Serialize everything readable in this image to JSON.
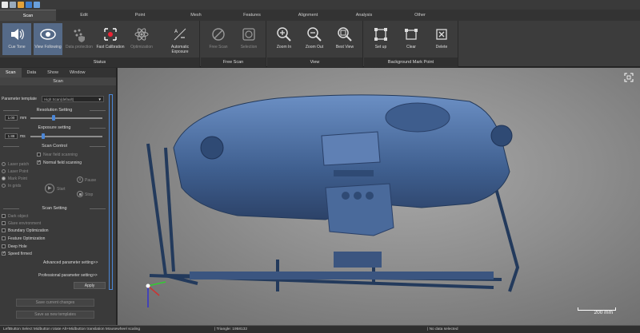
{
  "menu_tabs": [
    "Scan",
    "Edit",
    "Point",
    "Mesh",
    "Features",
    "Alignment",
    "Analysis",
    "Other"
  ],
  "ribbon": {
    "status_group": {
      "title": "Status",
      "buttons": [
        "Cue Tone",
        "View Following",
        "Data protection",
        "Fast Calibration",
        "Optimization",
        "Automatic Exposure"
      ]
    },
    "free_scan_group": {
      "title": "Free Scan",
      "buttons": [
        "Free Scan",
        "Selection"
      ]
    },
    "view_group": {
      "title": "View",
      "buttons": [
        "Zoom In",
        "Zoom Out",
        "Best View"
      ]
    },
    "mark_group": {
      "title": "Background Mark Point",
      "buttons": [
        "Set up",
        "Clear",
        "Delete"
      ]
    }
  },
  "panel": {
    "tabs": [
      "Scan",
      "Data",
      "Show",
      "Window"
    ],
    "heading": "Scan",
    "param_label": "Parameter template",
    "param_value": "High Scan(default)",
    "resolution": {
      "title": "Resolution Setting",
      "value": "1.00",
      "unit": "mm",
      "level": 0.3
    },
    "exposure": {
      "title": "Exposure setting",
      "value": "1.88",
      "unit": "ms",
      "level": 0.15
    },
    "scan_control": {
      "title": "Scan Control",
      "far_field": "Near field scanning",
      "normal_field": "Normal field scanning",
      "modes": [
        "Laser patch",
        "Laser Point",
        "Mark Point",
        "In grids"
      ],
      "start": "Start",
      "pause": "Pause",
      "stop": "Stop"
    },
    "scan_setting": {
      "title": "Scan Setting",
      "items": [
        {
          "label": "Dark object",
          "checked": false,
          "enabled": false
        },
        {
          "label": "Glare environment",
          "checked": false,
          "enabled": false
        },
        {
          "label": "Boundary Optimization",
          "checked": false,
          "enabled": true
        },
        {
          "label": "Feature Optimization",
          "checked": false,
          "enabled": true
        },
        {
          "label": "Deep Hole",
          "checked": false,
          "enabled": true
        },
        {
          "label": "Speed firmed",
          "checked": true,
          "enabled": true
        }
      ]
    },
    "advanced": "Advanced parameter setting>>",
    "professional": "Professional parameter setting>>",
    "apply": "Apply",
    "save_changes": "Save current changes",
    "save_template": "Save as new templates"
  },
  "viewport": {
    "scale_label": "200 mm"
  },
  "status_bar": {
    "hint": "LeftButton Select Midbutton rotate Alt+Midbutton translation Mousewheel scaling",
    "triangles": "| Triangle: 1958132",
    "selection": "| No data selected"
  },
  "colors": {
    "accent": "#4b86d6",
    "model": "#5878a8",
    "active_button": "#556a88"
  }
}
